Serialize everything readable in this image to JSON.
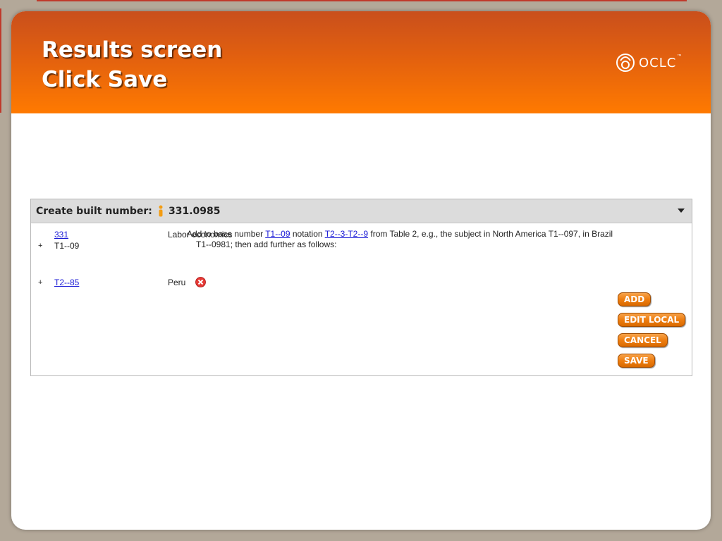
{
  "slide": {
    "title_line1": "Results screen",
    "title_line2": "Click Save",
    "logo_text": "OCLC",
    "logo_tm": "™"
  },
  "panel": {
    "header_label": "Create built number:",
    "built_number": "331.0985",
    "rows": [
      {
        "number": "331",
        "linked": true,
        "prefix": "",
        "description": "Labor economics"
      },
      {
        "number": "T1--09",
        "linked": false,
        "prefix": "+",
        "description": ""
      },
      {
        "number": "T2--85",
        "linked": true,
        "prefix": "+",
        "description": "Peru"
      }
    ],
    "note": {
      "text1": "Add to base number ",
      "link1": "T1--09",
      "text2": " notation ",
      "link2": "T2--3-T2--9",
      "text3": " from Table 2, e.g., the subject in North America T1--097, in Brazil",
      "line2": "T1--0981; then add further as follows:"
    }
  },
  "buttons": {
    "add": "ADD",
    "edit_local": "EDIT LOCAL",
    "cancel": "CANCEL",
    "save": "SAVE"
  },
  "colors": {
    "header_orange": "#ff7a00",
    "button_orange": "#ee7d10",
    "link_blue": "#1a1ad6"
  }
}
